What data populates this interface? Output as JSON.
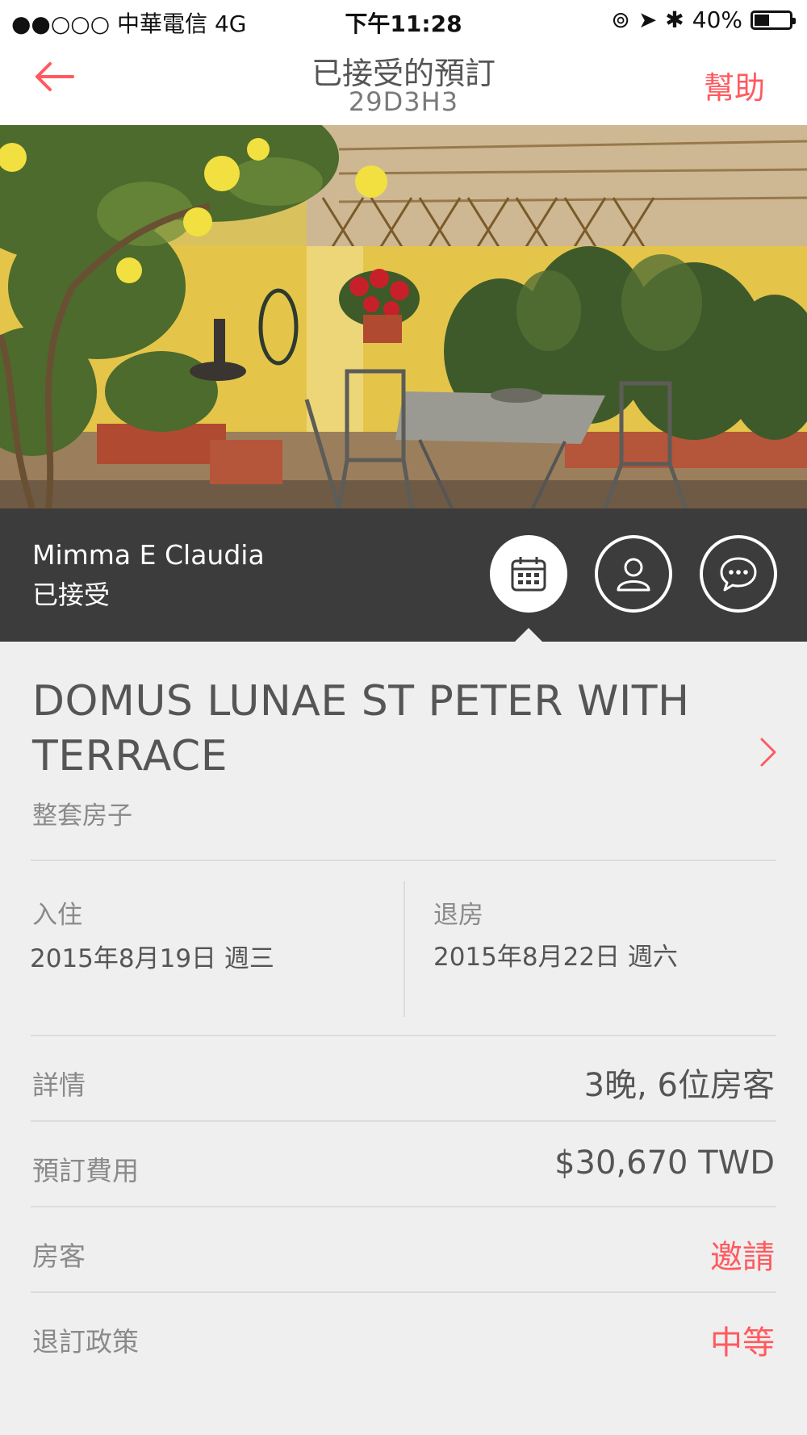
{
  "status_bar": {
    "carrier": "●●○○○ 中華電信   4G",
    "time": "下午11:28",
    "battery": "40%"
  },
  "nav": {
    "title": "已接受的預訂",
    "subtitle": "29D3H3",
    "help": "幫助"
  },
  "hero": {
    "scene": "terrace-photo"
  },
  "host": {
    "name": "Mimma E Claudia",
    "status": "已接受"
  },
  "listing": {
    "title": "DOMUS LUNAE ST PETER WITH TERRACE",
    "type": "整套房子"
  },
  "dates": {
    "checkin_label": "入住",
    "checkin_value": "2015年8月19日 週三",
    "checkout_label": "退房",
    "checkout_value": "2015年8月22日 週六"
  },
  "rows": [
    {
      "label": "詳情",
      "value": "3晚, 6位房客"
    },
    {
      "label": "預訂費用",
      "value": "$30,670 TWD"
    },
    {
      "label": "房客",
      "value": "邀請"
    },
    {
      "label": "退訂政策",
      "value": "中等"
    }
  ],
  "colors": {
    "accent": "#ff5a5f",
    "host_bar": "#3c3c3c"
  }
}
